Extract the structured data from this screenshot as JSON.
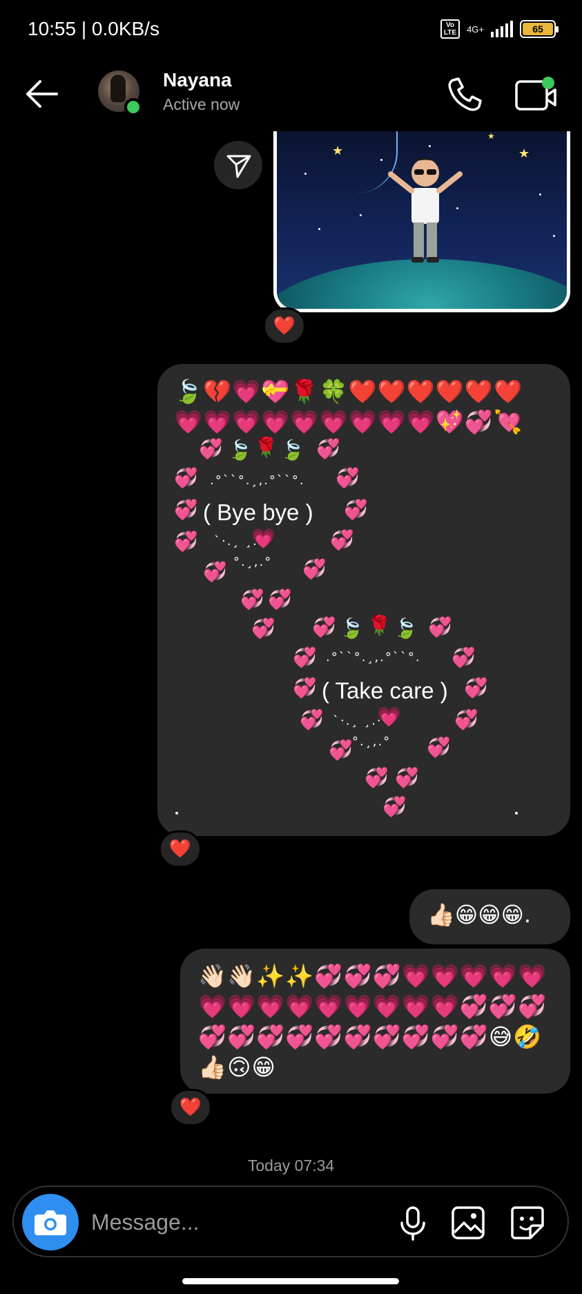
{
  "status_bar": {
    "time": "10:55 | 0.0KB/s",
    "volte": "Vo LTE",
    "network": "4G+",
    "battery": "65"
  },
  "header": {
    "name": "Nayana",
    "status": "Active now"
  },
  "messages": {
    "emoji_art": {
      "row1": "🍃💔💗💝🌹🍀❤️❤️❤️❤️❤️❤️",
      "row2": "💗💗💗💗💗💗💗💗💗💖💞💘",
      "heart1_label": "(   Bye bye   )",
      "heart2_label": "( Take care  )"
    },
    "thumbs_reply": "👍🏻😁😁😁.",
    "emoji_message": {
      "line1": "👋🏻👋🏻✨✨💞💞💞💗💗💗💗💗",
      "line2": "💗💗💗💗💗💗💗💗💗💞💞💞",
      "line3": "💞💞💞💞💞💞💞💞💞💞😅🤣",
      "line4": "👍🏻🙃😁"
    },
    "reaction": "❤️"
  },
  "timestamp": "Today 07:34",
  "composer": {
    "placeholder": "Message..."
  }
}
